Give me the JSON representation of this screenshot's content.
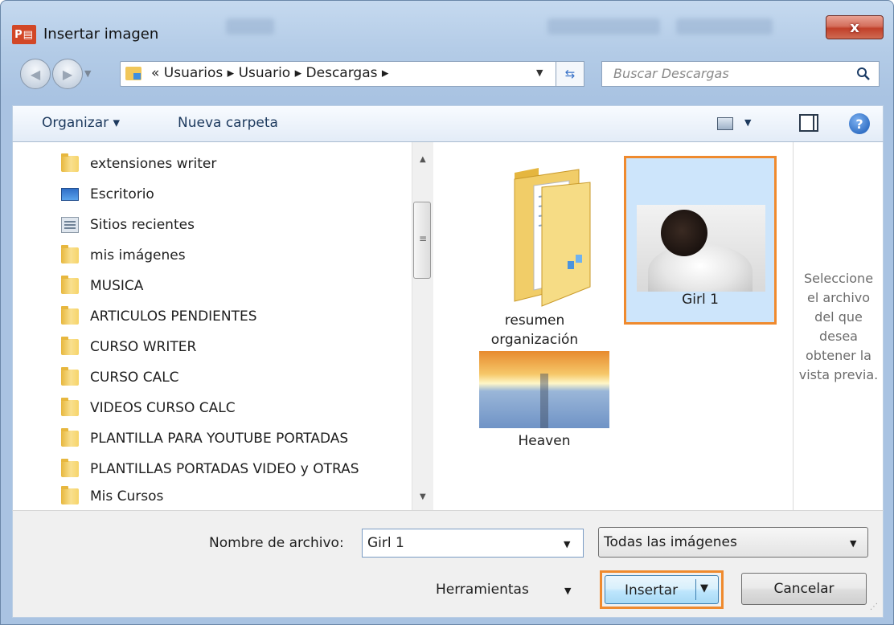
{
  "window": {
    "title": "Insertar imagen",
    "app_icon_text": "P",
    "close_symbol": "x"
  },
  "address": {
    "path": "« Usuarios ▸ Usuario ▸ Descargas ▸"
  },
  "search": {
    "placeholder": "Buscar Descargas"
  },
  "toolbar": {
    "organize_label": "Organizar ▾",
    "new_folder_label": "Nueva carpeta",
    "help_symbol": "?"
  },
  "nav_pane": {
    "items": [
      {
        "label": "extensiones writer",
        "icon": "folder-icon"
      },
      {
        "label": "Escritorio",
        "icon": "desktop-icon"
      },
      {
        "label": "Sitios recientes",
        "icon": "recent-places-icon"
      },
      {
        "label": "mis imágenes",
        "icon": "folder-icon"
      },
      {
        "label": "MUSICA",
        "icon": "folder-icon"
      },
      {
        "label": "ARTICULOS PENDIENTES",
        "icon": "folder-icon"
      },
      {
        "label": "CURSO WRITER",
        "icon": "folder-icon"
      },
      {
        "label": "CURSO CALC",
        "icon": "folder-icon"
      },
      {
        "label": "VIDEOS CURSO CALC",
        "icon": "folder-icon"
      },
      {
        "label": "PLANTILLA PARA YOUTUBE PORTADAS",
        "icon": "folder-icon"
      },
      {
        "label": "PLANTILLAS PORTADAS VIDEO y OTRAS",
        "icon": "folder-icon"
      },
      {
        "label": "Mis Cursos",
        "icon": "folder-icon"
      }
    ]
  },
  "files": {
    "folder_label_line1": "resumen",
    "folder_label_line2": "organización",
    "girl_label": "Girl 1",
    "heaven_label": "Heaven"
  },
  "preview": {
    "lines": [
      "Seleccione",
      "el archivo",
      "del que",
      "desea",
      "obtener la",
      "vista previa."
    ]
  },
  "bottom": {
    "filename_label": "Nombre de archivo:",
    "filename_value": "Girl 1",
    "filetype_value": "Todas las imágenes",
    "tools_label": "Herramientas",
    "insert_label": "Insertar",
    "cancel_label": "Cancelar"
  },
  "colors": {
    "highlight_border": "#ef8a2e",
    "selected_bg": "#cde5fb"
  }
}
